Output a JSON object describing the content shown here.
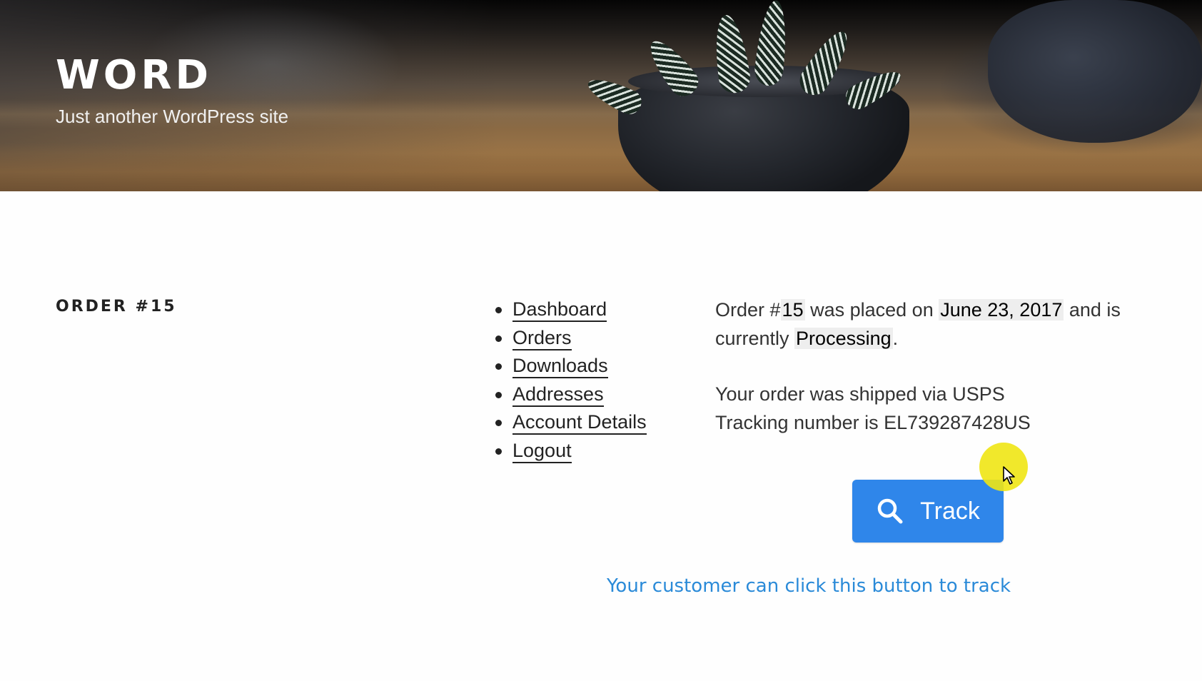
{
  "header": {
    "site_title": "WORD",
    "site_description": "Just another WordPress site"
  },
  "page": {
    "title": "ORDER #15"
  },
  "account_nav": {
    "items": [
      {
        "label": "Dashboard"
      },
      {
        "label": "Orders"
      },
      {
        "label": "Downloads"
      },
      {
        "label": "Addresses"
      },
      {
        "label": "Account Details"
      },
      {
        "label": "Logout"
      }
    ]
  },
  "order": {
    "sentence_prefix": "Order #",
    "number": "15",
    "sentence_placed": " was placed on ",
    "date": "June 23, 2017",
    "sentence_status": " and is currently ",
    "status": "Processing",
    "sentence_end": ".",
    "shipping_line": "Your order was shipped via USPS",
    "tracking_line": "Tracking number is EL739287428US"
  },
  "track_button": {
    "label": "Track",
    "color": "#2f86ea"
  },
  "caption": {
    "text": "Your customer can click this button to track",
    "color": "#2a8ad8"
  }
}
